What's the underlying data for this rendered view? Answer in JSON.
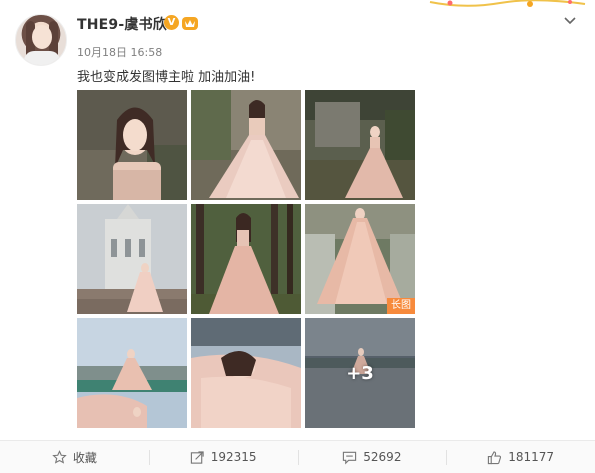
{
  "post": {
    "username": "THE9-虞书欣",
    "verified_badge": "V",
    "timestamp": "10月18日 16:58",
    "text": "我也变成发图博主啦 加油加油!",
    "more_count": "+3",
    "long_image_tag": "长图"
  },
  "toolbar": {
    "favorite_label": "收藏",
    "repost_count": "192315",
    "comment_count": "52692",
    "like_count": "181177"
  },
  "icons": {
    "favorite": "star-icon",
    "repost": "share-arrow-icon",
    "comment": "comment-bubble-icon",
    "like": "thumbs-up-icon",
    "menu": "chevron-down-icon"
  },
  "colors": {
    "badge_orange": "#f5a623",
    "long_tag": "#f78a3c",
    "text_primary": "#333333",
    "text_muted": "#808080"
  }
}
